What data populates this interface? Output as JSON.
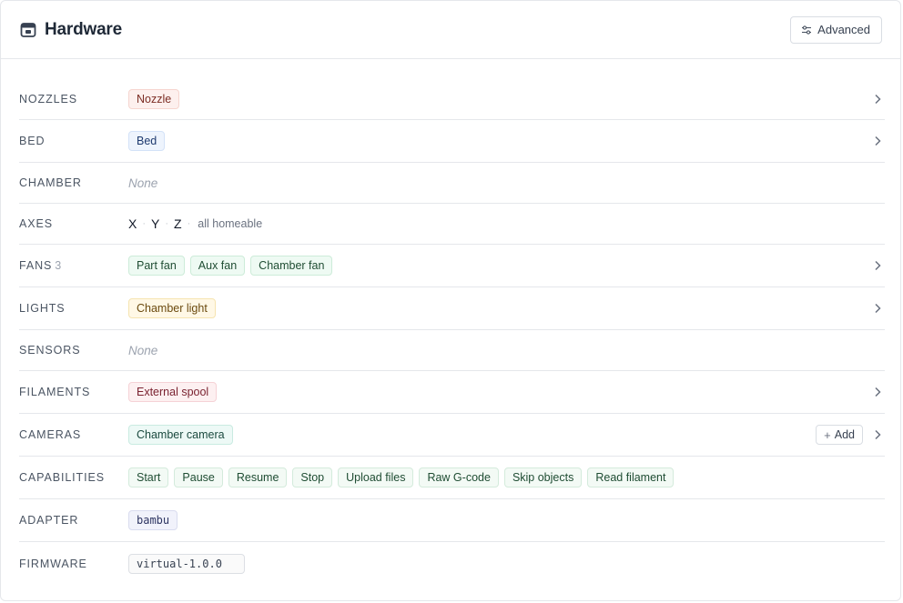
{
  "header": {
    "title": "Hardware",
    "advanced_label": "Advanced"
  },
  "rows": {
    "nozzles": {
      "label": "NOZZLES",
      "chips": [
        "Nozzle"
      ]
    },
    "bed": {
      "label": "BED",
      "chips": [
        "Bed"
      ]
    },
    "chamber": {
      "label": "CHAMBER",
      "empty": "None"
    },
    "axes": {
      "label": "AXES",
      "items": [
        "X",
        "Y",
        "Z"
      ],
      "note": "all homeable"
    },
    "fans": {
      "label": "FANS",
      "count": "3",
      "chips": [
        "Part fan",
        "Aux fan",
        "Chamber fan"
      ]
    },
    "lights": {
      "label": "LIGHTS",
      "chips": [
        "Chamber light"
      ]
    },
    "sensors": {
      "label": "SENSORS",
      "empty": "None"
    },
    "filaments": {
      "label": "FILAMENTS",
      "chips": [
        "External spool"
      ]
    },
    "cameras": {
      "label": "CAMERAS",
      "chips": [
        "Chamber camera"
      ],
      "add_label": "Add"
    },
    "capabilities": {
      "label": "CAPABILITIES",
      "chips": [
        "Start",
        "Pause",
        "Resume",
        "Stop",
        "Upload files",
        "Raw G-code",
        "Skip objects",
        "Read filament"
      ]
    },
    "adapter": {
      "label": "ADAPTER",
      "value": "bambu"
    },
    "firmware": {
      "label": "FIRMWARE",
      "value": "virtual-1.0.0"
    }
  },
  "icons": {
    "header": "printer-icon",
    "advanced": "sliders-icon",
    "row_action": "chevron-right-icon",
    "add": "plus-icon"
  },
  "colors": {
    "border": "#e5e7eb",
    "label": "#4b5563",
    "muted": "#9ca3af"
  }
}
